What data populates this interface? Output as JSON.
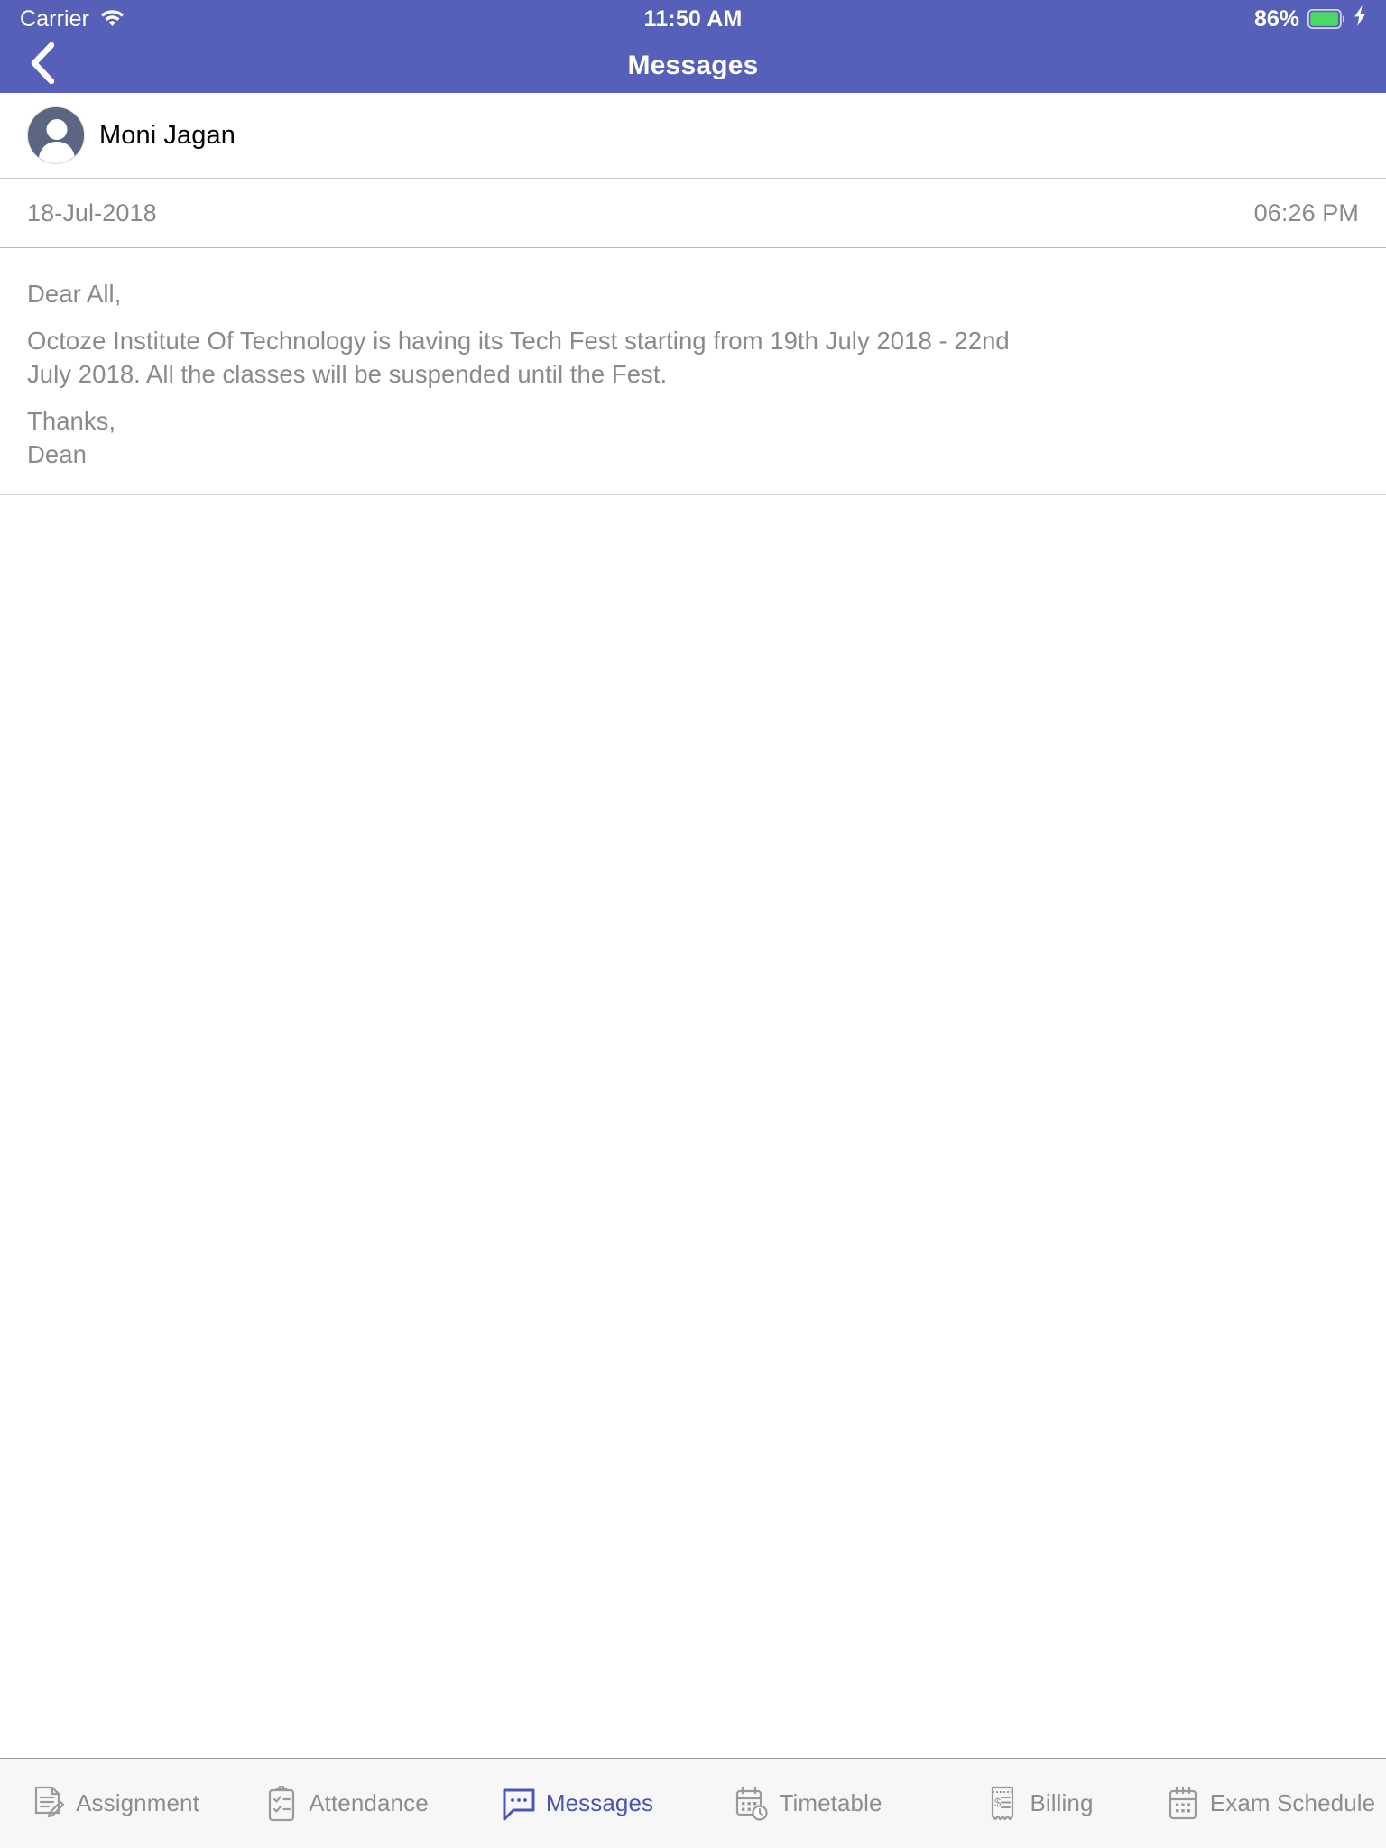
{
  "status_bar": {
    "carrier": "Carrier",
    "wifi_icon": "wifi-icon",
    "time": "11:50 AM",
    "battery_percent": "86%",
    "battery_icon": "battery-icon",
    "charging_icon": "lightning-bolt-icon",
    "battery_fill_color": "#4cd964",
    "text_color": "#ffffff"
  },
  "nav_bar": {
    "back_icon": "chevron-left-icon",
    "title": "Messages",
    "background_color": "#5660b8",
    "title_color": "#ffffff"
  },
  "sender": {
    "avatar_icon": "person-avatar-icon",
    "name": "Moni Jagan",
    "avatar_bg_color": "#5c6683"
  },
  "meta": {
    "date": "18-Jul-2018",
    "time": "06:26 PM",
    "text_color": "#898989"
  },
  "message": {
    "greeting": "Dear All,",
    "paragraph": "Octoze Institute Of Technology is having its Tech Fest starting from 19th July 2018 - 22nd July 2018. All the classes will be suspended until the Fest.",
    "signoff": "Thanks,",
    "signature": "Dean",
    "text_color": "#8a8a8a"
  },
  "tab_bar": {
    "background_color": "#f7f7f7",
    "inactive_color": "#8d8d8d",
    "active_color": "#4a55b5",
    "items": [
      {
        "label": "Assignment",
        "icon": "assignment-document-pencil-icon",
        "active": false
      },
      {
        "label": "Attendance",
        "icon": "clipboard-checklist-icon",
        "active": false
      },
      {
        "label": "Messages",
        "icon": "speech-bubble-icon",
        "active": true
      },
      {
        "label": "Timetable",
        "icon": "calendar-clock-icon",
        "active": false
      },
      {
        "label": "Billing",
        "icon": "receipt-dollar-icon",
        "active": false
      },
      {
        "label": "Exam Schedule",
        "icon": "calendar-grid-icon",
        "active": false
      }
    ]
  }
}
